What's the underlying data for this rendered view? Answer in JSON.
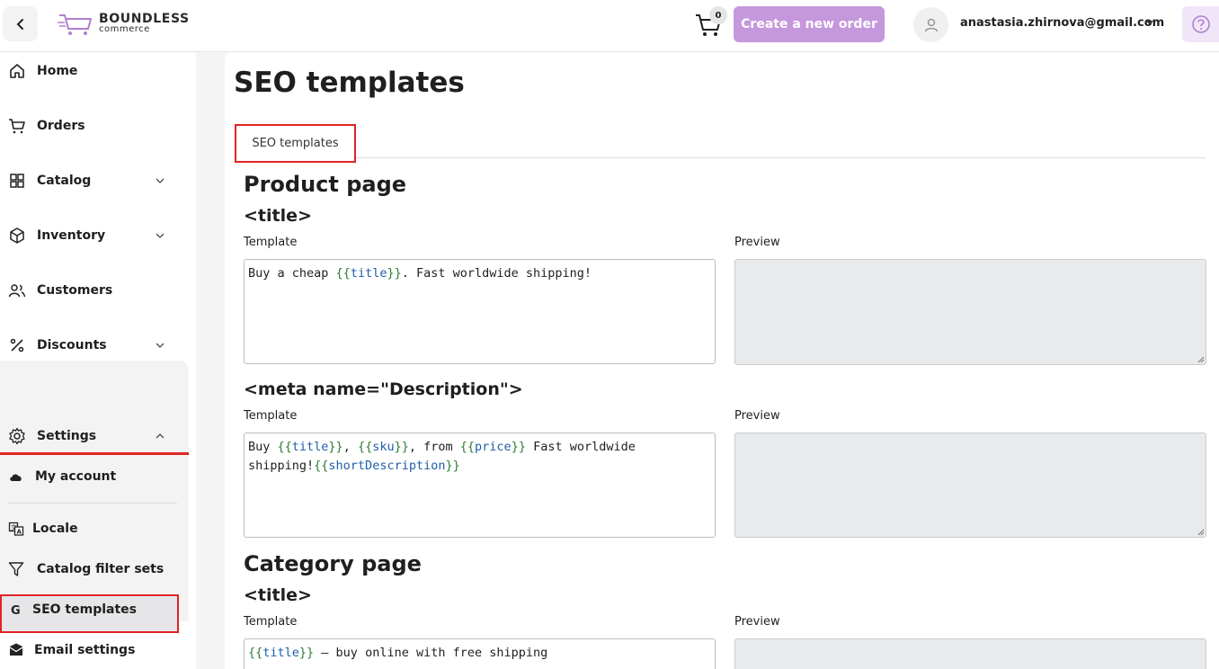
{
  "header": {
    "logo_main": "BOUNDLESS",
    "logo_sub": "commerce",
    "cart_count": "0",
    "create_order_label": "Create a new order",
    "user_email": "anastasia.zhirnova@gmail.com",
    "accent_color": "#c597dc"
  },
  "sidebar": {
    "items": [
      {
        "label": "Home",
        "icon": "home-icon"
      },
      {
        "label": "Orders",
        "icon": "cart-icon"
      },
      {
        "label": "Catalog",
        "icon": "grid-icon"
      },
      {
        "label": "Inventory",
        "icon": "box-icon"
      },
      {
        "label": "Customers",
        "icon": "users-icon"
      },
      {
        "label": "Discounts",
        "icon": "percent-icon"
      },
      {
        "label": "Settings",
        "icon": "gear-icon"
      }
    ],
    "settings_items": [
      {
        "label": "My account",
        "icon": "cloud-icon"
      },
      {
        "label": "Locale",
        "icon": "translate-icon"
      },
      {
        "label": "Catalog filter sets",
        "icon": "filter-icon"
      },
      {
        "label": "SEO templates",
        "icon": "google-icon"
      },
      {
        "label": "Email settings",
        "icon": "envelope-icon"
      }
    ]
  },
  "main": {
    "title": "SEO templates",
    "tab_label": "SEO templates",
    "template_label": "Template",
    "preview_label": "Preview",
    "product_section": "Product page",
    "category_section": "Category page",
    "title_tag": "<title>",
    "meta_tag": "<meta name=\"Description\">",
    "product_title_tpl": {
      "pre": "Buy a cheap ",
      "open": "{{",
      "var": "title",
      "close": "}}",
      "post": ". Fast worldwide shipping!"
    },
    "product_meta_tpl": {
      "t1": "Buy ",
      "v1": "title",
      "t2": ", ",
      "v2": "sku",
      "t3": ", from ",
      "v3": "price",
      "t4": " Fast worldwide\nshipping!",
      "v4": "shortDescription"
    },
    "category_title_tpl": {
      "var": "title",
      "post": " – buy online with free shipping"
    }
  }
}
